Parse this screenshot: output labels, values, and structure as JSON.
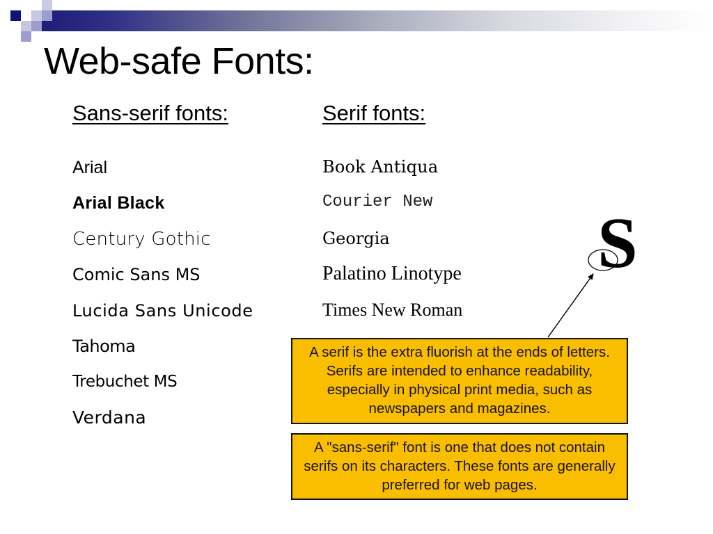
{
  "slide": {
    "title": "Web-safe Fonts:",
    "theme_colors": {
      "navy": "#1e1e7a",
      "lavender": "#c3c4e0",
      "periwinkle": "#9b9ccc",
      "note_fill": "#f9be00",
      "note_border": "#111111"
    }
  },
  "columns": {
    "sans_serif": {
      "heading": "Sans-serif fonts:",
      "items": [
        "Arial",
        "Arial Black",
        "Century Gothic",
        "Comic Sans MS",
        "Lucida Sans Unicode",
        "Tahoma",
        "Trebuchet MS",
        "Verdana"
      ]
    },
    "serif": {
      "heading": "Serif fonts:",
      "items": [
        "Book Antiqua",
        "Courier New",
        "Georgia",
        "Palatino Linotype",
        "Times New Roman"
      ]
    }
  },
  "illustration": {
    "letter": "S",
    "callout": "serif-highlight-ellipse-with-arrow"
  },
  "notes": {
    "serif_note": "A serif is the extra fluorish at the ends of letters.  Serifs are intended to enhance readability, especially in physical print media, such as newspapers and magazines.",
    "sans_serif_note": "A \"sans-serif\" font is one that does not contain serifs on its characters.  These fonts are generally preferred for web pages."
  }
}
